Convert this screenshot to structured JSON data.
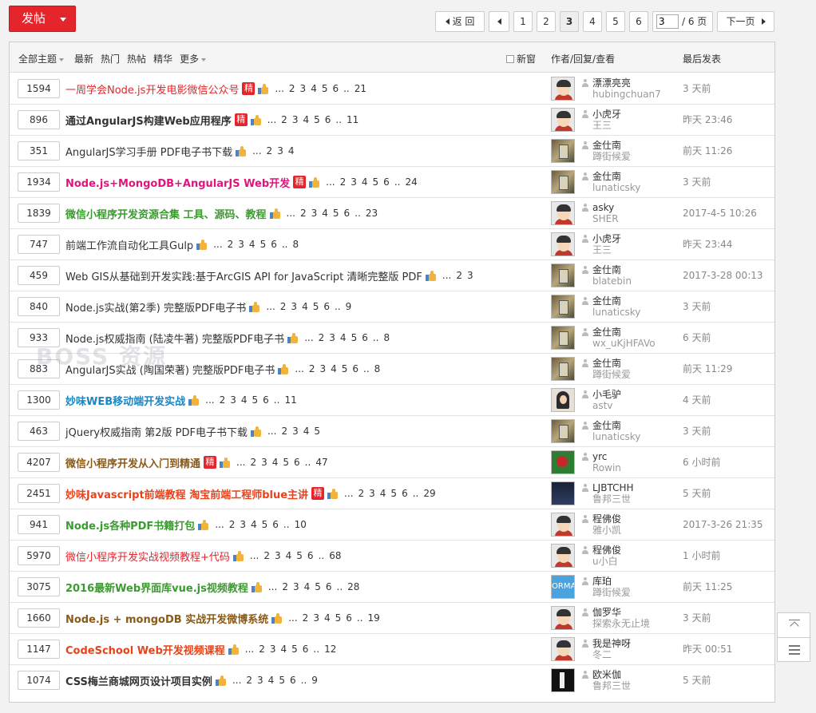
{
  "post_button": {
    "label": "发帖"
  },
  "pager": {
    "prev": "返 回",
    "pages": [
      "1",
      "2",
      "3",
      "4",
      "5",
      "6"
    ],
    "current": "3",
    "input_value": "3",
    "total": "/ 6 页",
    "next": "下一页"
  },
  "header": {
    "filters": {
      "all": "全部主题",
      "latest": "最新",
      "hot": "热门",
      "hot_posts": "热帖",
      "digest": "精华",
      "more": "更多"
    },
    "new_window": "新窗",
    "author_col": "作者/回复/查看",
    "last_col": "最后发表"
  },
  "colors": {
    "red": "#e4262c",
    "pink": "#e0157c",
    "green": "#3a9b2f",
    "blue": "#1b86c4",
    "brown": "#8a5a17",
    "orange": "#e8431a",
    "dark": "#333333"
  },
  "watermark": "BOSS 资源",
  "threads": [
    {
      "count": "1594",
      "title": "一周学会Node.js开发电影微信公众号",
      "color": "#e4262c",
      "bold": false,
      "jing": true,
      "pages": [
        "...",
        "2",
        "3",
        "4",
        "5",
        "6",
        "..",
        "21"
      ],
      "author": "漂漂亮亮",
      "replier": "hubingchuan7",
      "last": "3 天前",
      "avatar": "boy",
      "avatar_text": ""
    },
    {
      "count": "896",
      "title": "通过AngularJS构建Web应用程序",
      "color": "#333333",
      "bold": true,
      "jing": true,
      "pages": [
        "...",
        "2",
        "3",
        "4",
        "5",
        "6",
        "..",
        "11"
      ],
      "author": "小虎牙",
      "replier": "王三",
      "last": "昨天 23:46",
      "avatar": "boy",
      "avatar_text": ""
    },
    {
      "count": "351",
      "title": "AngularJS学习手册 PDF电子书下载",
      "color": "#333333",
      "bold": false,
      "jing": false,
      "pages": [
        "...",
        "2",
        "3",
        "4"
      ],
      "author": "金仕南",
      "replier": "蹲街候爱",
      "last": "前天 11:26",
      "avatar": "photo",
      "avatar_text": ""
    },
    {
      "count": "1934",
      "title": "Node.js+MongoDB+AngularJS Web开发",
      "color": "#e0157c",
      "bold": true,
      "jing": true,
      "pages": [
        "...",
        "2",
        "3",
        "4",
        "5",
        "6",
        "..",
        "24"
      ],
      "author": "金仕南",
      "replier": "lunaticsky",
      "last": "3 天前",
      "avatar": "photo",
      "avatar_text": ""
    },
    {
      "count": "1839",
      "title": "微信小程序开发资源合集 工具、源码、教程",
      "color": "#3a9b2f",
      "bold": true,
      "jing": false,
      "pages": [
        "...",
        "2",
        "3",
        "4",
        "5",
        "6",
        "..",
        "23"
      ],
      "author": "asky",
      "replier": "SHER",
      "last": "2017-4-5 10:26",
      "avatar": "boy",
      "avatar_text": ""
    },
    {
      "count": "747",
      "title": "前端工作流自动化工具Gulp",
      "color": "#333333",
      "bold": false,
      "jing": false,
      "pages": [
        "...",
        "2",
        "3",
        "4",
        "5",
        "6",
        "..",
        "8"
      ],
      "author": "小虎牙",
      "replier": "王三",
      "last": "昨天 23:44",
      "avatar": "boy",
      "avatar_text": ""
    },
    {
      "count": "459",
      "title": "Web GIS从基础到开发实践:基于ArcGIS API for JavaScript 清晰完整版 PDF",
      "color": "#333333",
      "bold": false,
      "jing": false,
      "pages": [
        "...",
        "2",
        "3"
      ],
      "author": "金仕南",
      "replier": "blatebin",
      "last": "2017-3-28 00:13",
      "avatar": "photo",
      "avatar_text": ""
    },
    {
      "count": "840",
      "title": "Node.js实战(第2季) 完整版PDF电子书",
      "color": "#333333",
      "bold": false,
      "jing": false,
      "pages": [
        "...",
        "2",
        "3",
        "4",
        "5",
        "6",
        "..",
        "9"
      ],
      "author": "金仕南",
      "replier": "lunaticsky",
      "last": "3 天前",
      "avatar": "photo",
      "avatar_text": ""
    },
    {
      "count": "933",
      "title": "Node.js权威指南 (陆凌牛著) 完整版PDF电子书",
      "color": "#333333",
      "bold": false,
      "jing": false,
      "pages": [
        "...",
        "2",
        "3",
        "4",
        "5",
        "6",
        "..",
        "8"
      ],
      "author": "金仕南",
      "replier": "wx_uKjHFAVo",
      "last": "6 天前",
      "avatar": "photo",
      "avatar_text": ""
    },
    {
      "count": "883",
      "title": "AngularJS实战 (陶国荣著) 完整版PDF电子书",
      "color": "#333333",
      "bold": false,
      "jing": false,
      "pages": [
        "...",
        "2",
        "3",
        "4",
        "5",
        "6",
        "..",
        "8"
      ],
      "author": "金仕南",
      "replier": "蹲街候爱",
      "last": "前天 11:29",
      "avatar": "photo",
      "avatar_text": ""
    },
    {
      "count": "1300",
      "title": "妙味WEB移动端开发实战",
      "color": "#1b86c4",
      "bold": true,
      "jing": false,
      "pages": [
        "...",
        "2",
        "3",
        "4",
        "5",
        "6",
        "..",
        "11"
      ],
      "author": "小毛驴",
      "replier": "astv",
      "last": "4 天前",
      "avatar": "girl",
      "avatar_text": ""
    },
    {
      "count": "463",
      "title": "jQuery权威指南 第2版 PDF电子书下载",
      "color": "#333333",
      "bold": false,
      "jing": false,
      "pages": [
        "...",
        "2",
        "3",
        "4",
        "5"
      ],
      "author": "金仕南",
      "replier": "lunaticsky",
      "last": "3 天前",
      "avatar": "photo",
      "avatar_text": ""
    },
    {
      "count": "4207",
      "title": "微信小程序开发从入门到精通",
      "color": "#8a5a17",
      "bold": true,
      "jing": true,
      "pages": [
        "...",
        "2",
        "3",
        "4",
        "5",
        "6",
        "..",
        "47"
      ],
      "author": "yrc",
      "replier": "Rowin",
      "last": "6 小时前",
      "avatar": "green",
      "avatar_text": ""
    },
    {
      "count": "2451",
      "title": "妙味Javascript前端教程 淘宝前端工程师blue主讲",
      "color": "#e8431a",
      "bold": true,
      "jing": true,
      "pages": [
        "...",
        "2",
        "3",
        "4",
        "5",
        "6",
        "..",
        "29"
      ],
      "author": "LJBTCHH",
      "replier": "鲁邦三世",
      "last": "5 天前",
      "avatar": "dark",
      "avatar_text": ""
    },
    {
      "count": "941",
      "title": "Node.js各种PDF书籍打包",
      "color": "#3a9b2f",
      "bold": true,
      "jing": false,
      "pages": [
        "...",
        "2",
        "3",
        "4",
        "5",
        "6",
        "..",
        "10"
      ],
      "author": "程佛俊",
      "replier": "雅小凯",
      "last": "2017-3-26 21:35",
      "avatar": "boy",
      "avatar_text": ""
    },
    {
      "count": "5970",
      "title": "微信小程序开发实战视频教程+代码",
      "color": "#e4262c",
      "bold": false,
      "jing": false,
      "pages": [
        "...",
        "2",
        "3",
        "4",
        "5",
        "6",
        "..",
        "68"
      ],
      "author": "程佛俊",
      "replier": "u小白",
      "last": "1 小时前",
      "avatar": "boy",
      "avatar_text": ""
    },
    {
      "count": "3075",
      "title": "2016最新Web界面库vue.js视频教程",
      "color": "#3a9b2f",
      "bold": true,
      "jing": false,
      "pages": [
        "...",
        "2",
        "3",
        "4",
        "5",
        "6",
        "..",
        "28"
      ],
      "author": "库珀",
      "replier": "蹲街候爱",
      "last": "前天 11:25",
      "avatar": "blue",
      "avatar_text": "ORMA"
    },
    {
      "count": "1660",
      "title": "Node.js + mongoDB 实战开发微博系统",
      "color": "#8a5a17",
      "bold": true,
      "jing": false,
      "pages": [
        "...",
        "2",
        "3",
        "4",
        "5",
        "6",
        "..",
        "19"
      ],
      "author": "伽罗华",
      "replier": "探索永无止境",
      "last": "3 天前",
      "avatar": "boy",
      "avatar_text": ""
    },
    {
      "count": "1147",
      "title": "CodeSchool Web开发视频课程",
      "color": "#e8431a",
      "bold": true,
      "jing": false,
      "pages": [
        "...",
        "2",
        "3",
        "4",
        "5",
        "6",
        "..",
        "12"
      ],
      "author": "我是神呀",
      "replier": "冬二",
      "last": "昨天 00:51",
      "avatar": "boy",
      "avatar_text": ""
    },
    {
      "count": "1074",
      "title": "CSS梅兰商城网页设计项目实例",
      "color": "#333333",
      "bold": true,
      "jing": false,
      "pages": [
        "...",
        "2",
        "3",
        "4",
        "5",
        "6",
        "..",
        "9"
      ],
      "author": "欧米伽",
      "replier": "鲁邦三世",
      "last": "5 天前",
      "avatar": "bw",
      "avatar_text": ""
    }
  ]
}
